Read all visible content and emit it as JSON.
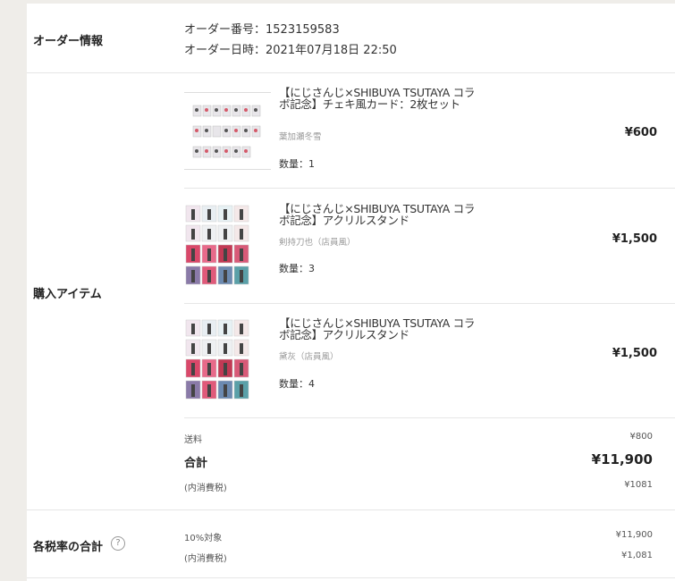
{
  "order_info": {
    "label": "オーダー情報",
    "number_line": "オーダー番号：1523159583",
    "date_line": "オーダー日時：2021年07月18日 22:50"
  },
  "items_section": {
    "label": "購入アイテム",
    "items": [
      {
        "title": "【にじさんじ×SHIBUYA TSUTAYA コラボ記念】チェキ風カード：2枚セット",
        "variant": "葉加瀬冬雪",
        "quantity": "数量：1",
        "price": "¥600"
      },
      {
        "title": "【にじさんじ×SHIBUYA TSUTAYA コラボ記念】アクリルスタンド",
        "variant": "剣持刀也（店員風）",
        "quantity": "数量：3",
        "price": "¥1,500"
      },
      {
        "title": "【にじさんじ×SHIBUYA TSUTAYA コラボ記念】アクリルスタンド",
        "variant": "黛灰（店員風）",
        "quantity": "数量：4",
        "price": "¥1,500"
      }
    ]
  },
  "summary": {
    "shipping_label": "送料",
    "shipping_value": "¥800",
    "total_label": "合計",
    "total_value": "¥11,900",
    "tax_label": "(内消費税)",
    "tax_value": "¥1081"
  },
  "tax_rate_section": {
    "label": "各税率の合計",
    "help_icon": "?",
    "rate_label": "10%対象",
    "rate_value": "¥11,900",
    "tax_label": "(内消費税)",
    "tax_value": "¥1,081"
  },
  "colors": {
    "background": "#efede9",
    "panel": "#ffffff",
    "divider": "#e6e6e6"
  }
}
